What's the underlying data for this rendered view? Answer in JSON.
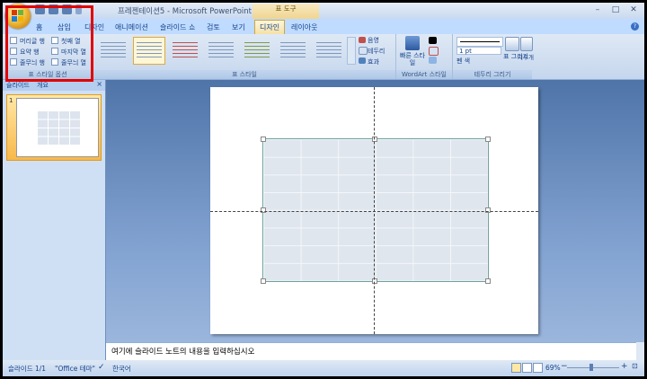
{
  "window": {
    "title": "프레젠테이션5 - Microsoft PowerPoint",
    "tool_context": "표 도구"
  },
  "window_buttons": [
    "–",
    "□",
    "✕"
  ],
  "tabs": [
    {
      "label": "홈"
    },
    {
      "label": "삽입"
    },
    {
      "label": "디자인"
    },
    {
      "label": "애니메이션"
    },
    {
      "label": "슬라이드 쇼"
    },
    {
      "label": "검토"
    },
    {
      "label": "보기"
    },
    {
      "label": "디자인"
    },
    {
      "label": "레이아웃"
    }
  ],
  "active_tab_index": 7,
  "ribbon": {
    "table_style_options": {
      "label": "표 스타일 옵션",
      "checkboxes": [
        {
          "label": "머리글 행"
        },
        {
          "label": "첫째 열"
        },
        {
          "label": "요약 행"
        },
        {
          "label": "마지막 열"
        },
        {
          "label": "줄무늬 행"
        },
        {
          "label": "줄무늬 열"
        }
      ]
    },
    "table_styles": {
      "label": "표 스타일",
      "commands": [
        "음영",
        "테두리",
        "효과"
      ]
    },
    "wordart": {
      "label": "WordArt 스타일",
      "quick_styles": "빠른 스타일"
    },
    "draw_borders": {
      "label": "테두리 그리기",
      "pen_weight": "1 pt",
      "pen_color": "펜 색",
      "draw_table": "표 그리기",
      "eraser": "지우개"
    }
  },
  "slides_panel": {
    "tab_label": "슬라이드",
    "outline_label": "개요",
    "close": "×",
    "slide_number": "1"
  },
  "notes": {
    "text": "여기에 슬라이드 노트의 내용을 입력하십시오"
  },
  "status": {
    "slide": "슬라이드 1/1",
    "theme": "\"Office 테마\"",
    "language": "한국어",
    "zoom": "69%"
  },
  "colors": {
    "highlight": "#e10000",
    "ribbon_bg": "#c5d6ed",
    "active_tab": "#f5e1a4"
  }
}
